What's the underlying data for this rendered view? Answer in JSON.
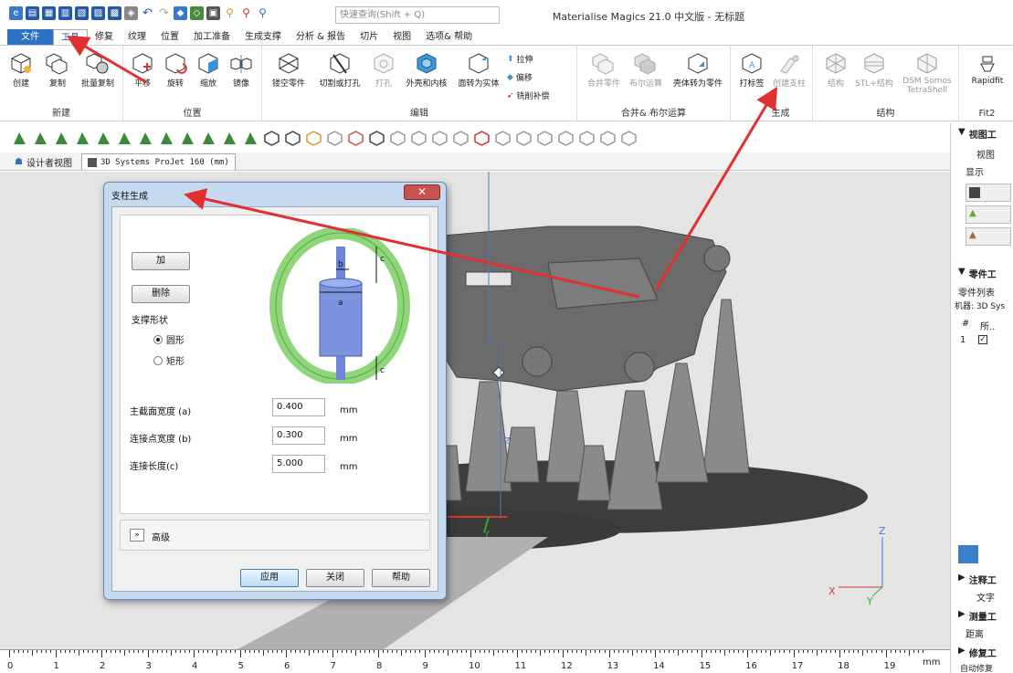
{
  "app": {
    "title": "Materialise Magics 21.0 中文版 - 无标题",
    "search_placeholder": "快速查询(Shift + Q)"
  },
  "tabs": [
    "文件",
    "工具",
    "修复",
    "纹理",
    "位置",
    "加工准备",
    "生成支撑",
    "分析 & 报告",
    "切片",
    "视图",
    "选项& 帮助"
  ],
  "ribbon": {
    "groups": {
      "new": {
        "label": "新建",
        "buttons": [
          "创建",
          "复制",
          "批量复制"
        ]
      },
      "position": {
        "label": "位置",
        "buttons": [
          "平移",
          "旋转",
          "缩放",
          "镜像"
        ]
      },
      "edit": {
        "label": "编辑",
        "buttons": [
          "镂空零件",
          "切割或打孔",
          "打孔",
          "外壳和内核",
          "面转为实体"
        ],
        "small": [
          "拉伸",
          "偏移",
          "铣削补偿"
        ]
      },
      "merge": {
        "label": "合并& 布尔运算",
        "buttons": [
          "合并零件",
          "布尔运算",
          "壳体转为零件"
        ]
      },
      "generate": {
        "label": "生成",
        "buttons": [
          "打标签",
          "创建支柱"
        ]
      },
      "structure": {
        "label": "结构",
        "buttons": [
          "结构",
          "STL+结构",
          "DSM Somos TetraShell"
        ]
      },
      "fit": {
        "label": "Fit2",
        "buttons": [
          "Rapidfit"
        ]
      }
    }
  },
  "view_tabs": {
    "designer": "设计者视图",
    "machine": "3D Systems ProJet 160 (mm)"
  },
  "dialog": {
    "title": "支柱生成",
    "add_label": "加",
    "delete_label": "删除",
    "shape_label": "支撑形状",
    "shape_options": [
      "圆形",
      "矩形"
    ],
    "shape_selected": "圆形",
    "fields": [
      {
        "label": "主截面宽度 (a)",
        "value": "0.400",
        "unit": "mm"
      },
      {
        "label": "连接点宽度 (b)",
        "value": "0.300",
        "unit": "mm"
      },
      {
        "label": "连接长度(c)",
        "value": "5.000",
        "unit": "mm"
      }
    ],
    "diagram_labels": {
      "a": "a",
      "b": "b",
      "c": "c"
    },
    "advanced_label": "高级",
    "apply_label": "应用",
    "close_label": "关闭",
    "help_label": "帮助"
  },
  "right_panel": {
    "view_tools": "视图工",
    "view_tab": "视图",
    "display": "显示",
    "part_tools": "零件工",
    "part_list": "零件列表",
    "machine": "机器: 3D Sys",
    "col_num": "#",
    "col_part": "所..",
    "row_num": "1",
    "annot_tools": "注释工",
    "text": "文字",
    "measure_tools": "测量工",
    "distance": "距离",
    "repair_tools": "修复工",
    "auto_repair": "自动修复"
  },
  "ruler": {
    "ticks": [
      "0",
      "1",
      "2",
      "3",
      "4",
      "5",
      "6",
      "7",
      "8",
      "9",
      "10",
      "11",
      "12",
      "13",
      "14",
      "15",
      "16",
      "17",
      "18",
      "19"
    ],
    "unit": "mm"
  },
  "axes": {
    "x": "X",
    "y": "Y",
    "z": "Z"
  },
  "colors": {
    "accent": "#2a72c4",
    "arrow": "#e03030",
    "ring": "#8fd67a",
    "pillar": "#6f86d8",
    "part": "#6b6b6b"
  }
}
